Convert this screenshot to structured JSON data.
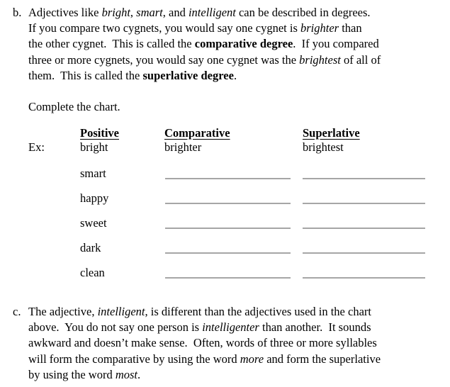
{
  "document": {
    "type": "grammar-worksheet",
    "topic": "Degrees of Adjectives"
  },
  "item_b": {
    "marker": "b.",
    "lines": [
      "Adjectives like |bright|, |smart|, and |intelligent| can be described in degrees.",
      "If you compare two cygnets, you would say one cygnet is |brighter| than",
      "the other cygnet.  This is called the *comparative degree*.  If you compared",
      "three or more cygnets, you would say one cygnet was the |brightest| of all of",
      "them.  This is called the *superlative degree*."
    ],
    "plain_text": "Adjectives like bright, smart, and intelligent can be described in degrees. If you compare two cygnets, you would say one cygnet is brighter than the other cygnet.  This is called the comparative degree.  If you compared three or more cygnets, you would say one cygnet was the brightest of all of them.  This is called the superlative degree.",
    "italic_words": [
      "bright",
      "smart",
      "intelligent",
      "brighter",
      "brightest"
    ],
    "bold_phrases": [
      "comparative degree",
      "superlative degree"
    ]
  },
  "instruction": {
    "text": "Complete the chart."
  },
  "chart": {
    "row_label_example": "Ex:",
    "headers": {
      "col0": "",
      "positive": "Positive",
      "comparative": "Comparative",
      "superlative": "Superlative"
    },
    "example_row": {
      "label": "Ex:",
      "positive": "bright",
      "comparative": "brighter",
      "superlative": "brightest"
    },
    "exercise_rows": [
      {
        "positive": "smart",
        "comparative": "",
        "superlative": ""
      },
      {
        "positive": "happy",
        "comparative": "",
        "superlative": ""
      },
      {
        "positive": "sweet",
        "comparative": "",
        "superlative": ""
      },
      {
        "positive": "dark",
        "comparative": "",
        "superlative": ""
      },
      {
        "positive": "clean",
        "comparative": "",
        "superlative": ""
      }
    ]
  },
  "item_c": {
    "marker": "c.",
    "lines": [
      "The adjective, |intelligent|, is different than the adjectives used in the chart",
      "above.  You do not say one person is |intelligenter| than another.  It sounds",
      "awkward and doesn’t make sense.  Often, words of three or more syllables",
      "will form the comparative by using the word |more| and form the superlative",
      "by using the word |most|."
    ],
    "plain_text": "The adjective, intelligent, is different than the adjectives used in the chart above.  You do not say one person is intelligenter than another.  It sounds awkward and doesn’t make sense.  Often, words of three or more syllables will form the comparative by using the word more and form the superlative by using the word most.",
    "italic_words": [
      "intelligent",
      "intelligenter",
      "more",
      "most"
    ]
  },
  "style": {
    "text_color": "#000000",
    "rule_color": "#a6a6a6",
    "background": "#ffffff"
  }
}
